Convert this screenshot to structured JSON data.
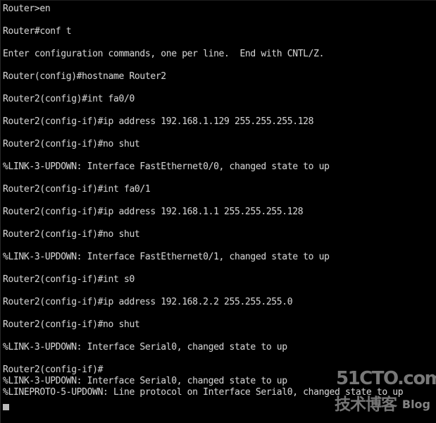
{
  "terminal": {
    "background_color": "#000000",
    "text_color": "#cfcfcf",
    "cursor_color": "#b9b9b9",
    "lines": [
      {
        "text": "Router>en",
        "spaced": true
      },
      {
        "text": "Router#conf t",
        "spaced": true
      },
      {
        "text": "Enter configuration commands, one per line.  End with CNTL/Z.",
        "spaced": true
      },
      {
        "text": "Router(config)#hostname Router2",
        "spaced": true
      },
      {
        "text": "Router2(config)#int fa0/0",
        "spaced": true
      },
      {
        "text": "Router2(config-if)#ip address 192.168.1.129 255.255.255.128",
        "spaced": true
      },
      {
        "text": "Router2(config-if)#no shut",
        "spaced": true
      },
      {
        "text": "%LINK-3-UPDOWN: Interface FastEthernet0/0, changed state to up",
        "spaced": true
      },
      {
        "text": "Router2(config-if)#int fa0/1",
        "spaced": true
      },
      {
        "text": "Router2(config-if)#ip address 192.168.1.1 255.255.255.128",
        "spaced": true
      },
      {
        "text": "Router2(config-if)#no shut",
        "spaced": true
      },
      {
        "text": "%LINK-3-UPDOWN: Interface FastEthernet0/1, changed state to up",
        "spaced": true
      },
      {
        "text": "Router2(config-if)#int s0",
        "spaced": true
      },
      {
        "text": "Router2(config-if)#ip address 192.168.2.2 255.255.255.0",
        "spaced": true
      },
      {
        "text": "Router2(config-if)#no shut",
        "spaced": true
      },
      {
        "text": "%LINK-3-UPDOWN: Interface Serial0, changed state to up",
        "spaced": true
      },
      {
        "text": "Router2(config-if)#",
        "spaced": false
      },
      {
        "text": "%LINK-3-UPDOWN: Interface Serial0, changed state to up",
        "spaced": false
      },
      {
        "text": "%LINEPROTO-5-UPDOWN: Line protocol on Interface Serial0, changed state to up",
        "spaced": false
      }
    ]
  },
  "watermark": {
    "site": "51CTO.com",
    "chinese": "技术博客",
    "english": "Blog",
    "color": "#8e8e8e"
  }
}
